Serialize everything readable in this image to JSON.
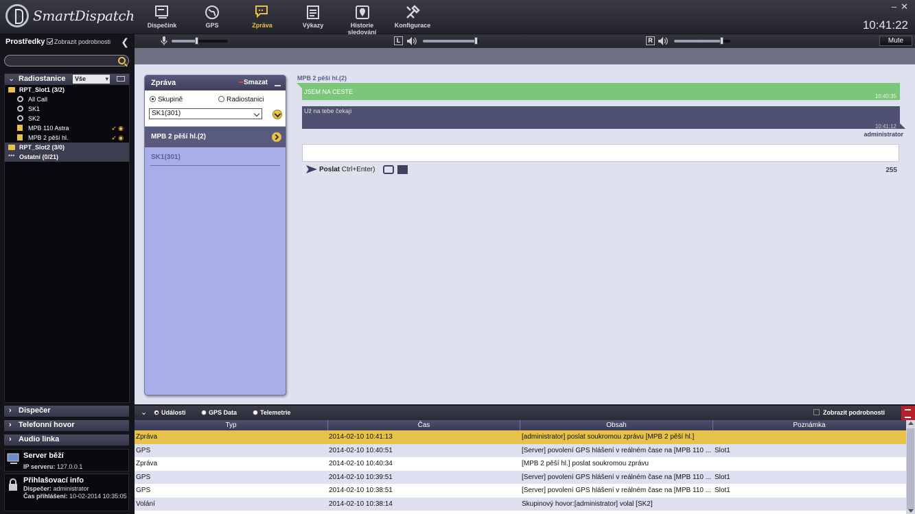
{
  "app": {
    "title": "SmartDispatch",
    "clock": "10:41:22"
  },
  "nav": [
    {
      "label": "Dispečink",
      "icon": "monitor-icon"
    },
    {
      "label": "GPS",
      "icon": "globe-icon"
    },
    {
      "label": "Zpráva",
      "icon": "message-icon",
      "active": true
    },
    {
      "label": "Výkazy",
      "icon": "report-icon"
    },
    {
      "label": "Historie sledování",
      "icon": "map-history-icon"
    },
    {
      "label": "Konfigurace",
      "icon": "tools-icon"
    }
  ],
  "audio": {
    "left_label": "L",
    "right_label": "R",
    "mute_label": "Mute",
    "mic_level": 0.45,
    "left_level": 0.95,
    "right_level": 0.85
  },
  "left_panel": {
    "title": "Prostředky",
    "show_details_label": "Zobrazit podrobnosti",
    "show_details_checked": true,
    "search_placeholder": "",
    "radios_header": "Radiostanice",
    "filter_value": "Vše",
    "tree": [
      {
        "label": "RPT_Slot1 (3/2)",
        "level": 0,
        "icon": "repeater-icon",
        "bold": true
      },
      {
        "label": "All Call",
        "level": 1,
        "icon": "group-icon"
      },
      {
        "label": "SK1",
        "level": 1,
        "icon": "group-icon"
      },
      {
        "label": "SK2",
        "level": 1,
        "icon": "group-icon"
      },
      {
        "label": "MPB 110 Astra",
        "level": 1,
        "icon": "radio-icon",
        "status": true
      },
      {
        "label": "MPB 2 pěší hl.",
        "level": 1,
        "icon": "radio-icon",
        "status": true
      },
      {
        "label": "RPT_Slot2 (3/0)",
        "level": 0,
        "icon": "repeater-icon",
        "bold": true,
        "highlight": true
      },
      {
        "label": "Ostatní (0/21)",
        "level": 0,
        "icon": "more-icon",
        "bold": true,
        "highlight": true
      }
    ],
    "sections": [
      "Dispečer",
      "Telefonní hovor",
      "Audio linka"
    ],
    "server": {
      "title": "Server běží",
      "ip_label": "IP serveru:",
      "ip": "127.0.0.1"
    },
    "login": {
      "title": "Přihlašovací info",
      "dispatcher_label": "Dispečer:",
      "dispatcher": "administrator",
      "time_label": "Čas přihlášení:",
      "time": "10-02-2014 10:35:05"
    }
  },
  "message_panel": {
    "title": "Zpráva",
    "delete_label": "Smazat",
    "radio_group": "Skupině",
    "radio_station": "Radiostanici",
    "selected_target": "SK1(301)",
    "conversations": [
      "MPB 2 pěší hl.(2)",
      "SK1(301)"
    ]
  },
  "chat": {
    "title": "MPB 2 pěší hl.(2)",
    "messages": [
      {
        "text": "JSEM NA CESTE",
        "time": "10:40:35"
      },
      {
        "text": "Už na tebe čekají",
        "time": "10:41:12"
      }
    ],
    "sender": "administrator",
    "send_label": "Poslat",
    "send_shortcut": "Ctrl+Enter)",
    "char_count": "255"
  },
  "log": {
    "tabs": [
      "Události",
      "GPS Data",
      "Telemetrie"
    ],
    "show_details_label": "Zobrazit podrobnosti",
    "columns": [
      "Typ",
      "Čas",
      "Obsah",
      "Poznámka"
    ],
    "rows": [
      [
        "Zpráva",
        "2014-02-10 10:41:13",
        "[administrator] poslat soukromou zprávu [MPB 2 pěší hl.]",
        ""
      ],
      [
        "GPS",
        "2014-02-10 10:40:51",
        "[Server] povolení GPS hlášení v reálném čase na [MPB 110 ...",
        "Slot1"
      ],
      [
        "Zpráva",
        "2014-02-10 10:40:34",
        "[MPB 2 pěší hl.] poslat soukromou zprávu",
        ""
      ],
      [
        "GPS",
        "2014-02-10 10:39:51",
        "[Server] povolení GPS hlášení v reálném čase na [MPB 110 ...",
        "Slot1"
      ],
      [
        "GPS",
        "2014-02-10 10:38:51",
        "[Server] povolení GPS hlášení v reálném čase na [MPB 110 ...",
        "Slot1"
      ],
      [
        "Volání",
        "2014-02-10 10:38:14",
        "Skupinový hovor:[administrator] volal [SK2]",
        ""
      ]
    ]
  }
}
